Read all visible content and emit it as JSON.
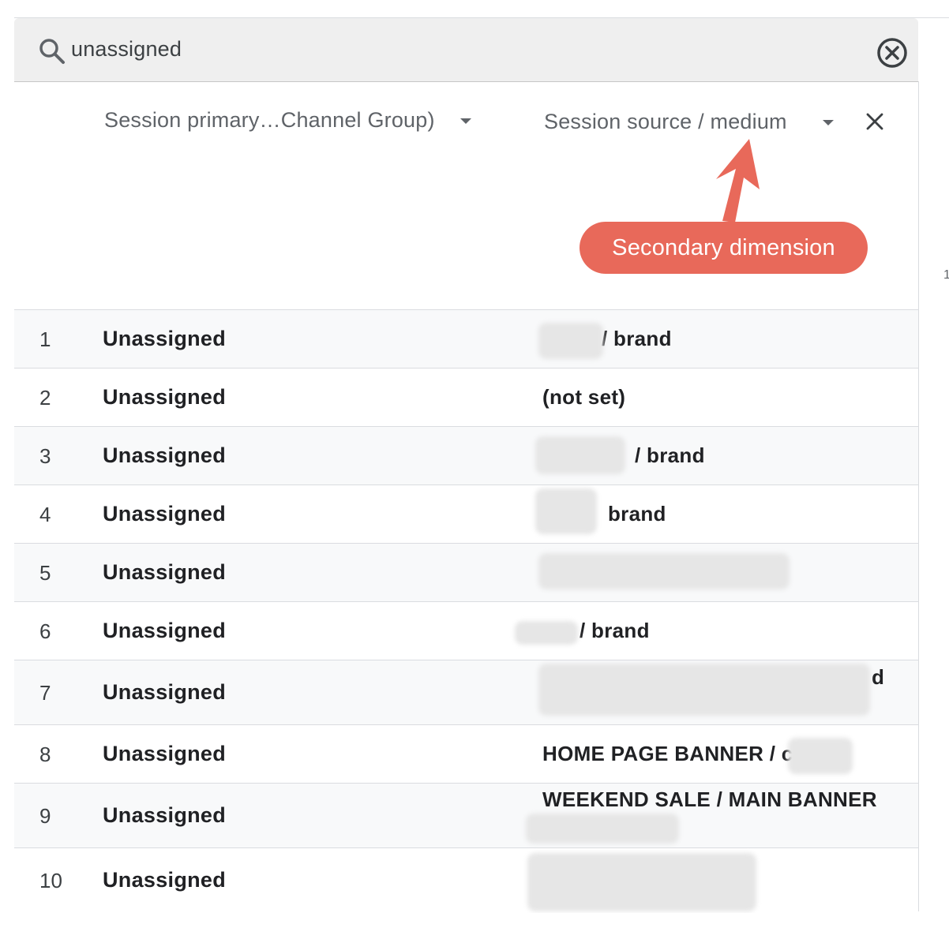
{
  "search": {
    "value": "unassigned"
  },
  "header": {
    "primary_dimension": "Session primary…Channel Group)",
    "secondary_dimension": "Session source / medium"
  },
  "annotation": {
    "label": "Secondary dimension",
    "color": "#e8695a"
  },
  "rows": [
    {
      "index": "1",
      "primary": "Unassigned",
      "secondary": "/ brand"
    },
    {
      "index": "2",
      "primary": "Unassigned",
      "secondary": "(not set)"
    },
    {
      "index": "3",
      "primary": "Unassigned",
      "secondary": "/ brand"
    },
    {
      "index": "4",
      "primary": "Unassigned",
      "secondary": "brand"
    },
    {
      "index": "5",
      "primary": "Unassigned",
      "secondary": ""
    },
    {
      "index": "6",
      "primary": "Unassigned",
      "secondary": "/ brand"
    },
    {
      "index": "7",
      "primary": "Unassigned",
      "secondary": "d"
    },
    {
      "index": "8",
      "primary": "Unassigned",
      "secondary": "HOME PAGE BANNER / c"
    },
    {
      "index": "9",
      "primary": "Unassigned",
      "secondary": "WEEKEND SALE / MAIN BANNER"
    },
    {
      "index": "10",
      "primary": "Unassigned",
      "secondary": ""
    }
  ],
  "icons": {
    "search": "search-icon",
    "clear": "clear-circle-icon",
    "remove_dimension": "close-icon",
    "dropdown": "caret-down-icon"
  }
}
